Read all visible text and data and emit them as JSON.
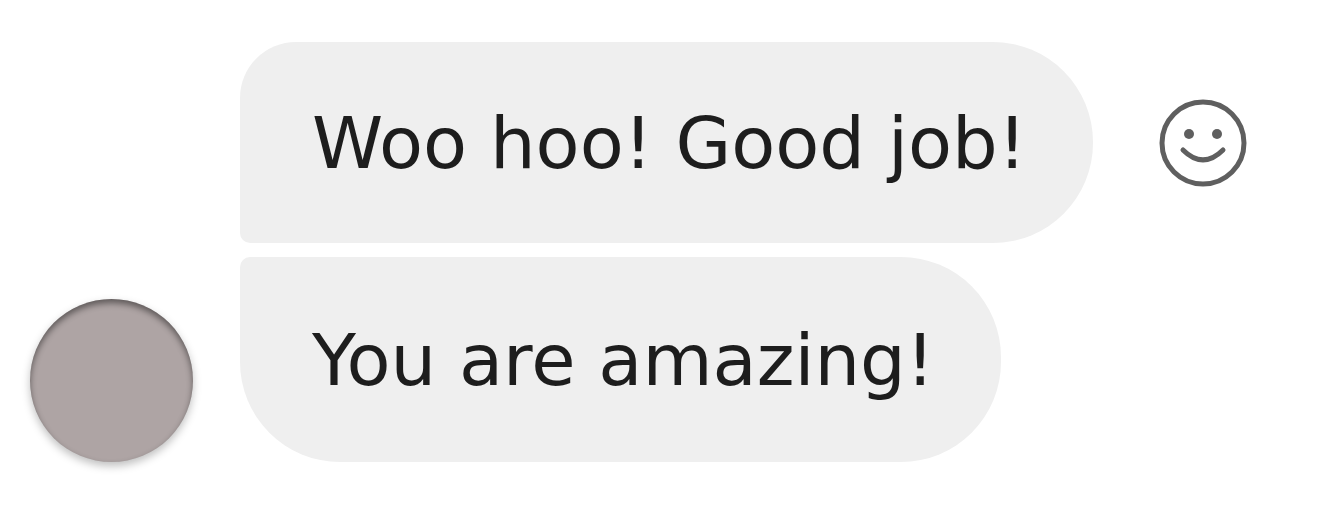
{
  "messages": [
    {
      "text": "Woo hoo! Good job!",
      "show_reaction": true,
      "show_avatar": false
    },
    {
      "text": "You are amazing!",
      "show_reaction": false,
      "show_avatar": true
    }
  ]
}
